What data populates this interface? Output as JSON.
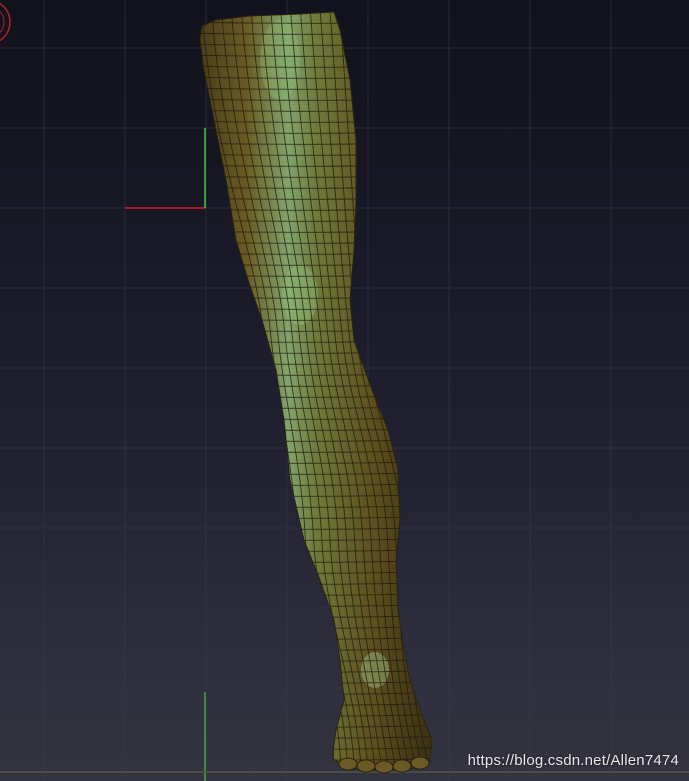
{
  "viewport": {
    "watermark": "https://blog.csdn.net/Allen7474",
    "background_top": "#12121d",
    "background_bottom": "#343440",
    "grid_color": "#3a3a4e",
    "axis_x_color": "#d8202a",
    "axis_y_color": "#3cc83c"
  },
  "model": {
    "name": "leg-mesh",
    "base_color": "#6b5a24",
    "highlight_color": "#7fa870",
    "wire_color": "#1e1a0e"
  }
}
